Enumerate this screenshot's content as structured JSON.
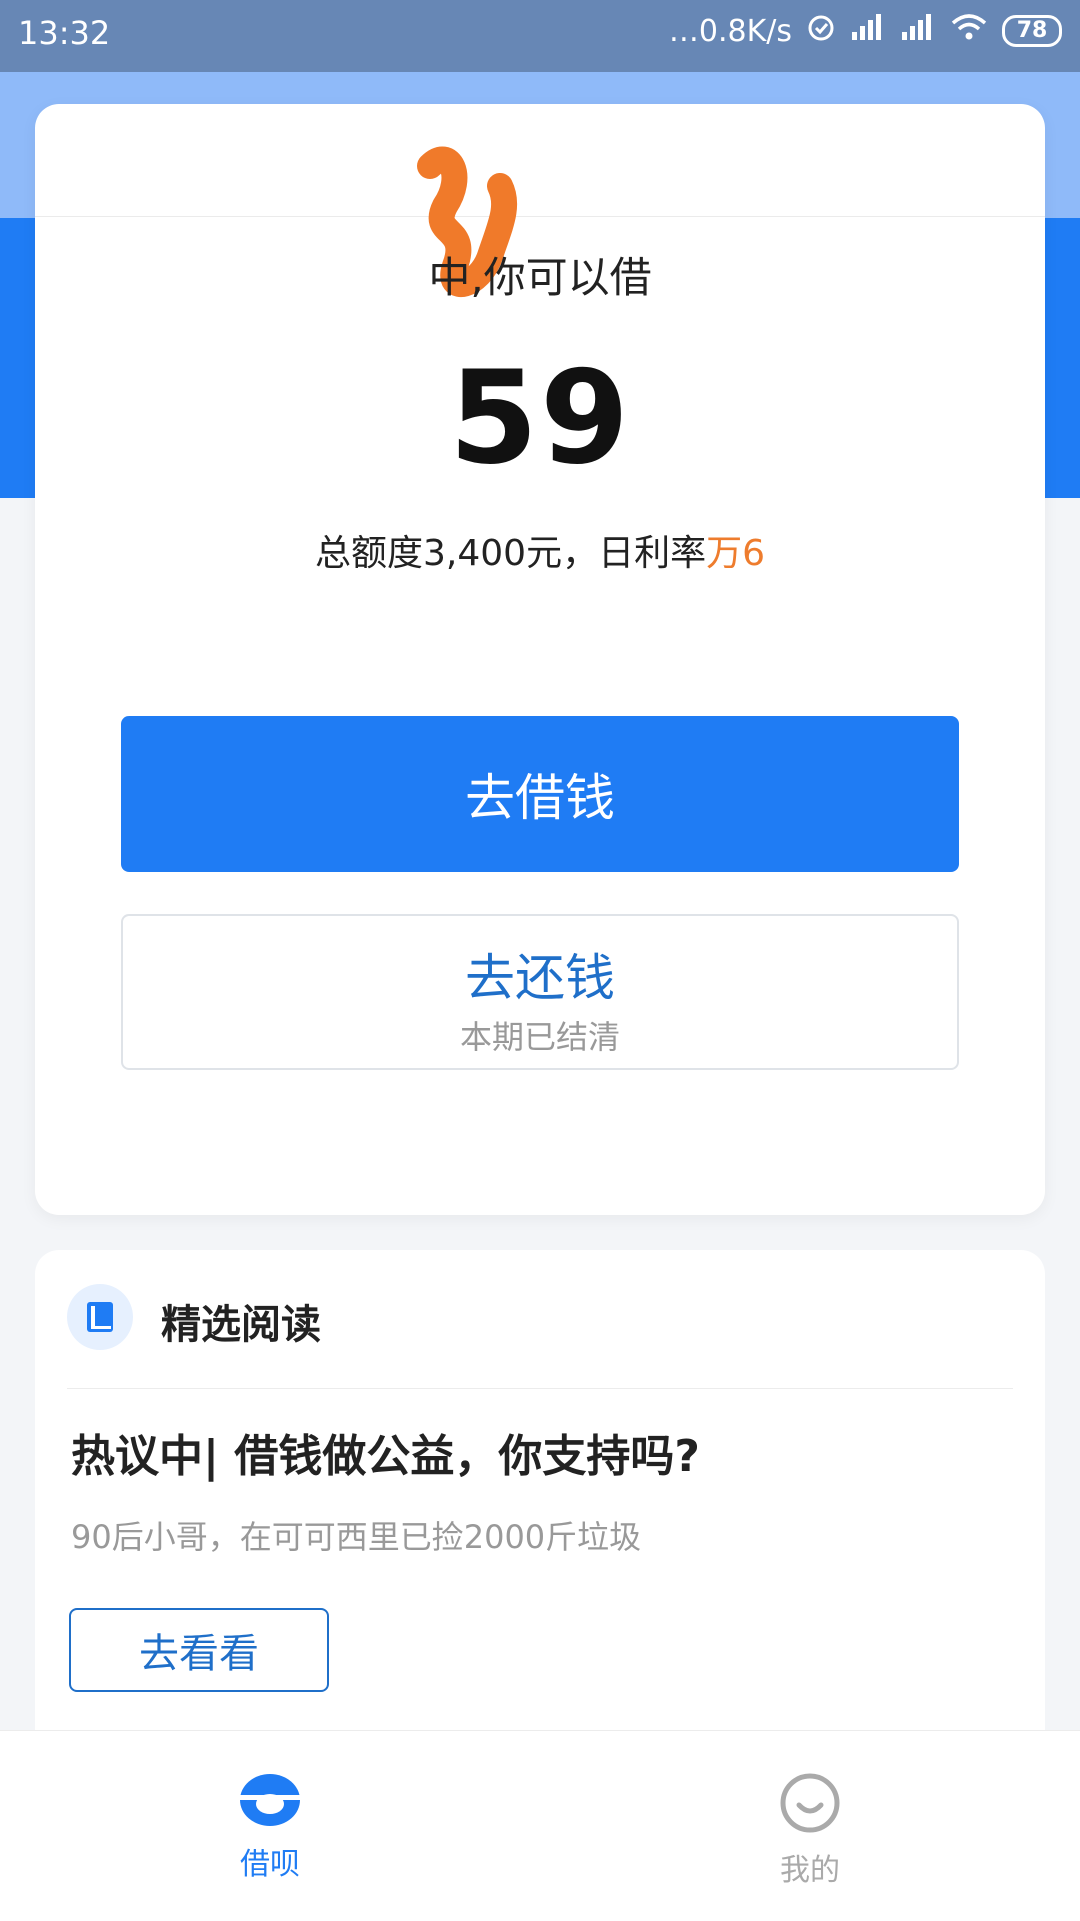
{
  "status_bar": {
    "time": "13:32",
    "network_speed": "…0.8K/s",
    "battery": "78"
  },
  "main_card": {
    "caption": "中,你可以借",
    "amount": "59",
    "quota_prefix": "总额度3,400元，日利率",
    "rate": "万6",
    "borrow_button": "去借钱",
    "repay_button": "去还钱",
    "repay_status": "本期已结清"
  },
  "reading": {
    "section_title": "精选阅读",
    "article_title": "热议中| 借钱做公益，你支持吗?",
    "article_subtitle": "90后小哥，在可可西里已捡2000斤垃圾",
    "view_button": "去看看"
  },
  "bottom_nav": {
    "items": [
      {
        "label": "借呗",
        "active": true
      },
      {
        "label": "我的",
        "active": false
      }
    ]
  },
  "colors": {
    "primary": "#1f7cf4",
    "accent": "#ee7c2d",
    "status_bar": "#6787b5"
  }
}
